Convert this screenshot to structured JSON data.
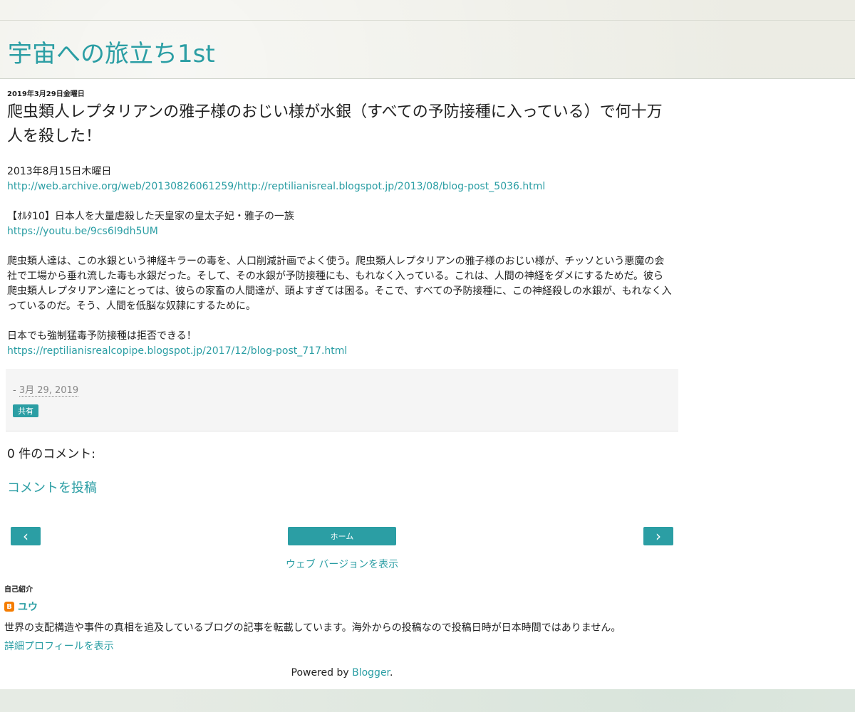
{
  "blog": {
    "title": "宇宙への旅立ち1st"
  },
  "post": {
    "date_header": "2019年3月29日金曜日",
    "title": "爬虫類人レプタリアンの雅子様のおじい様が水銀（すべての予防接種に入っている）で何十万人を殺した！",
    "body": {
      "date_line": "2013年8月15日木曜日",
      "archive_link": "http://web.archive.org/web/20130826061259/http://reptilianisreal.blogspot.jp/2013/08/blog-post_5036.html",
      "video_title": "【ｵﾙﾀ10】日本人を大量虐殺した天皇家の皇太子妃・雅子の一族",
      "video_link": "https://youtu.be/9cs6I9dh5UM",
      "paragraph": "爬虫類人達は、この水銀という神経キラーの毒を、人口削減計画でよく使う。爬虫類人レプタリアンの雅子様のおじい様が、チッソという悪魔の会社で工場から垂れ流した毒も水銀だった。そして、その水銀が予防接種にも、もれなく入っている。これは、人間の神経をダメにするためだ。彼ら爬虫類人レプタリアン達にとっては、彼らの家畜の人間達が、頭よすぎては困る。そこで、すべての予防接種に、この神経殺しの水銀が、もれなく入っているのだ。そう、人間を低脳な奴隷にするために。",
      "closing_line": "日本でも強制猛毒予防接種は拒否できる！",
      "closing_link": "https://reptilianisrealcopipe.blogspot.jp/2017/12/blog-post_717.html"
    },
    "footer": {
      "timestamp_prefix": "- ",
      "timestamp": "3月 29, 2019",
      "share_label": "共有"
    }
  },
  "comments": {
    "header": "0 件のコメント:",
    "post_link": "コメントを投稿"
  },
  "pager": {
    "newer": "‹",
    "home": "ホーム",
    "older": "›"
  },
  "web_version": "ウェブ バージョンを表示",
  "profile": {
    "title": "自己紹介",
    "icon": "blogger-icon",
    "icon_glyph": "B",
    "name": "ユウ",
    "description": "世界の支配構造や事件の真相を追及しているブログの記事を転載しています。海外からの投稿なので投稿日時が日本時間ではありません。",
    "more_link": "詳細プロフィールを表示"
  },
  "powered": {
    "prefix": "Powered by ",
    "link": "Blogger",
    "suffix": "."
  },
  "colors": {
    "accent": "#2b9ea4",
    "blogger_orange": "#f57d00"
  }
}
